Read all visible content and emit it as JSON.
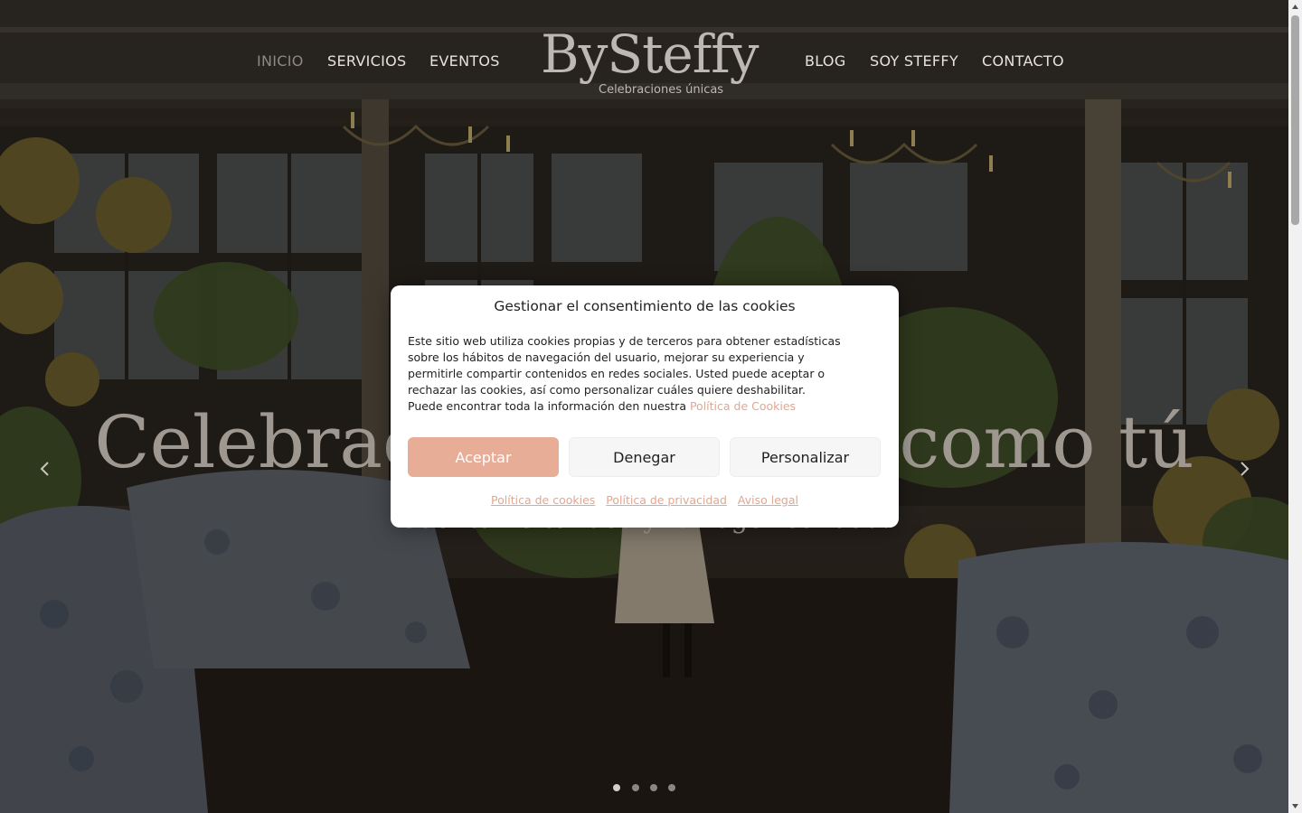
{
  "header": {
    "nav_left": [
      "INICIO",
      "SERVICIOS",
      "EVENTOS"
    ],
    "nav_right": [
      "BLOG",
      "SOY STEFFY",
      "CONTACTO"
    ],
    "active_item": "INICIO",
    "logo": {
      "name": "BySteffy",
      "tagline": "Celebraciones únicas"
    }
  },
  "hero": {
    "title": "Celebraciones únicas como tú",
    "subtitle": "Cuéntame tu idea y lo hago realidad.",
    "prev_icon": "chevron-left-icon",
    "next_icon": "chevron-right-icon",
    "slide_count": 4,
    "active_slide": 1
  },
  "cookie_modal": {
    "title": "Gestionar el consentimiento de las cookies",
    "body": "Este sitio web utiliza cookies propias y de terceros para obtener estadísticas sobre los hábitos de navegación del usuario, mejorar su experiencia y permitirle compartir contenidos en redes sociales. Usted puede aceptar o rechazar las cookies, así como personalizar cuáles quiere deshabilitar.",
    "body_line2": "Puede encontrar toda la información den nuestra",
    "body_link": "Política de Cookies",
    "buttons": {
      "accept": "Aceptar",
      "deny": "Denegar",
      "customize": "Personalizar"
    },
    "footer_links": [
      "Política de cookies",
      "Política de privacidad",
      "Aviso legal"
    ]
  },
  "colors": {
    "accent": "#e8ad97",
    "link": "#e4a68e",
    "nav_text": "#e7e2da",
    "nav_active": "#8d8882"
  }
}
